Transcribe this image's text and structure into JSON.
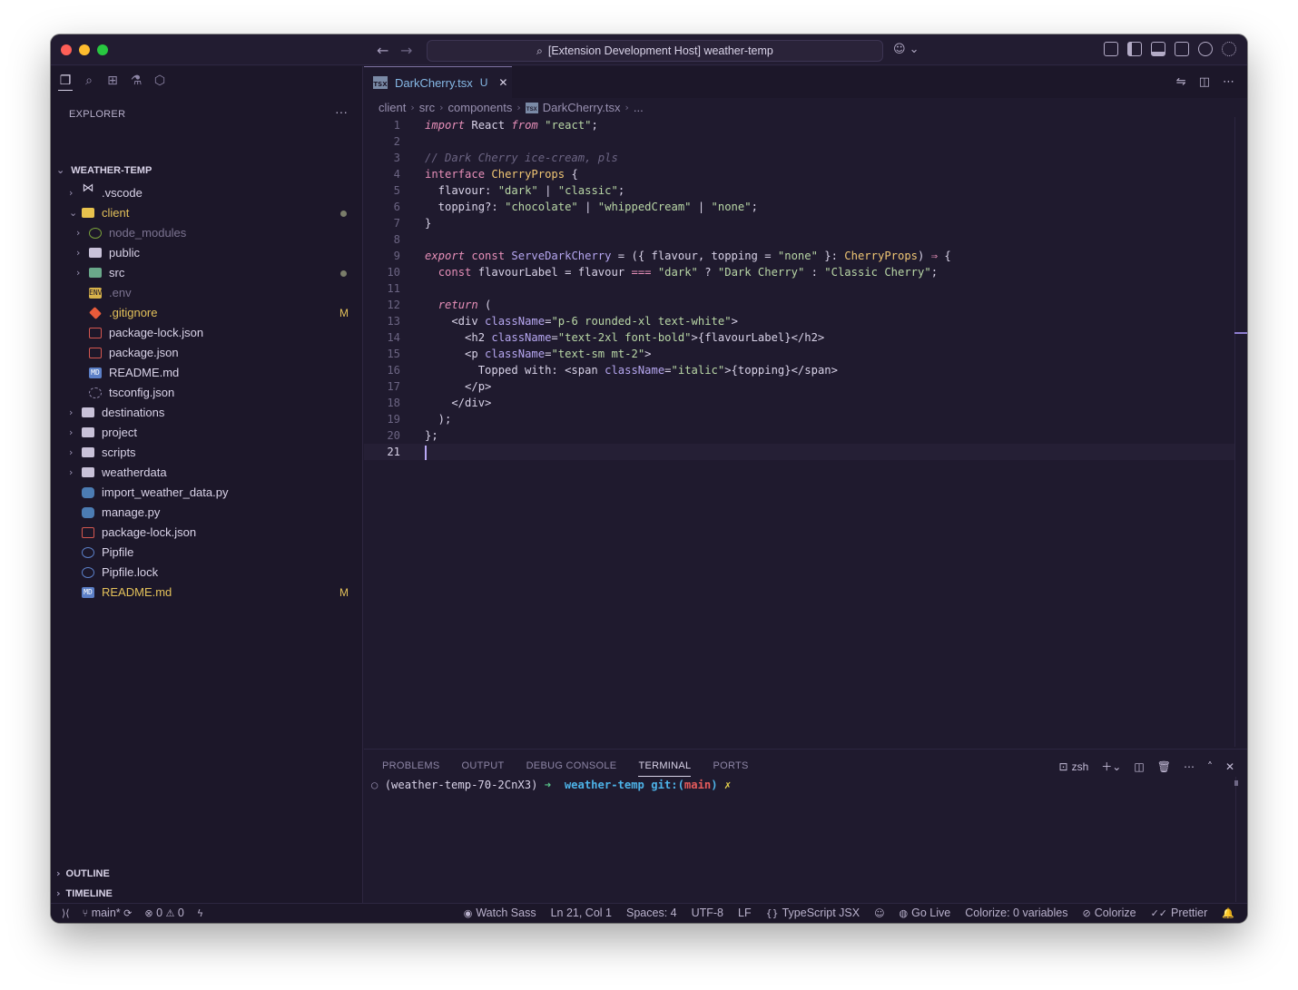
{
  "window": {
    "command_center": "[Extension Development Host] weather-temp"
  },
  "explorer": {
    "title": "EXPLORER",
    "more": "···",
    "root": "WEATHER-TEMP",
    "items": [
      {
        "name": ".vscode",
        "depth": 1,
        "kind": "folder-vs",
        "expanded": false
      },
      {
        "name": "client",
        "depth": 1,
        "kind": "folder-open",
        "expanded": true,
        "dot": true,
        "color": "yellow"
      },
      {
        "name": "node_modules",
        "depth": 2,
        "kind": "node",
        "expanded": false,
        "dim": true
      },
      {
        "name": "public",
        "depth": 2,
        "kind": "folder",
        "expanded": false
      },
      {
        "name": "src",
        "depth": 2,
        "kind": "folder-src",
        "expanded": false,
        "dot": true
      },
      {
        "name": ".env",
        "depth": 2,
        "kind": "env",
        "dim": true
      },
      {
        "name": ".gitignore",
        "depth": 2,
        "kind": "git",
        "badge": "M",
        "color": "yellow"
      },
      {
        "name": "package-lock.json",
        "depth": 2,
        "kind": "json"
      },
      {
        "name": "package.json",
        "depth": 2,
        "kind": "json"
      },
      {
        "name": "README.md",
        "depth": 2,
        "kind": "md"
      },
      {
        "name": "tsconfig.json",
        "depth": 2,
        "kind": "ts"
      },
      {
        "name": "destinations",
        "depth": 1,
        "kind": "folder",
        "expanded": false
      },
      {
        "name": "project",
        "depth": 1,
        "kind": "folder",
        "expanded": false
      },
      {
        "name": "scripts",
        "depth": 1,
        "kind": "folder",
        "expanded": false
      },
      {
        "name": "weatherdata",
        "depth": 1,
        "kind": "folder",
        "expanded": false
      },
      {
        "name": "import_weather_data.py",
        "depth": 1,
        "kind": "py"
      },
      {
        "name": "manage.py",
        "depth": 1,
        "kind": "py"
      },
      {
        "name": "package-lock.json",
        "depth": 1,
        "kind": "json"
      },
      {
        "name": "Pipfile",
        "depth": 1,
        "kind": "pip"
      },
      {
        "name": "Pipfile.lock",
        "depth": 1,
        "kind": "pip"
      },
      {
        "name": "README.md",
        "depth": 1,
        "kind": "md",
        "badge": "M",
        "color": "yellow"
      }
    ],
    "outline": "OUTLINE",
    "timeline": "TIMELINE"
  },
  "editor": {
    "tab": {
      "name": "DarkCherry.tsx",
      "status": "U",
      "icon": "TSX"
    },
    "breadcrumb": [
      "client",
      "src",
      "components",
      "DarkCherry.tsx",
      "..."
    ],
    "current_line": 21,
    "lines": [
      [
        {
          "t": "import",
          "c": "kw"
        },
        {
          "t": " React ",
          "c": ""
        },
        {
          "t": "from",
          "c": "kw"
        },
        {
          "t": " ",
          "c": ""
        },
        {
          "t": "\"react\"",
          "c": "str"
        },
        {
          "t": ";",
          "c": ""
        }
      ],
      [],
      [
        {
          "t": "// Dark Cherry ice-cream, pls",
          "c": "cm"
        }
      ],
      [
        {
          "t": "interface",
          "c": "kw2"
        },
        {
          "t": " ",
          "c": ""
        },
        {
          "t": "CherryProps",
          "c": "ty"
        },
        {
          "t": " {",
          "c": ""
        }
      ],
      [
        {
          "t": "  flavour: ",
          "c": ""
        },
        {
          "t": "\"dark\"",
          "c": "str"
        },
        {
          "t": " | ",
          "c": ""
        },
        {
          "t": "\"classic\"",
          "c": "str"
        },
        {
          "t": ";",
          "c": ""
        }
      ],
      [
        {
          "t": "  topping?: ",
          "c": ""
        },
        {
          "t": "\"chocolate\"",
          "c": "str"
        },
        {
          "t": " | ",
          "c": ""
        },
        {
          "t": "\"whippedCream\"",
          "c": "str"
        },
        {
          "t": " | ",
          "c": ""
        },
        {
          "t": "\"none\"",
          "c": "str"
        },
        {
          "t": ";",
          "c": ""
        }
      ],
      [
        {
          "t": "}",
          "c": ""
        }
      ],
      [],
      [
        {
          "t": "export",
          "c": "kw"
        },
        {
          "t": " ",
          "c": ""
        },
        {
          "t": "const",
          "c": "kw2"
        },
        {
          "t": " ",
          "c": ""
        },
        {
          "t": "ServeDarkCherry",
          "c": "fn"
        },
        {
          "t": " = ({ flavour, topping = ",
          "c": ""
        },
        {
          "t": "\"none\"",
          "c": "str"
        },
        {
          "t": " }: ",
          "c": ""
        },
        {
          "t": "CherryProps",
          "c": "ty"
        },
        {
          "t": ") ",
          "c": ""
        },
        {
          "t": "⇒",
          "c": "op"
        },
        {
          "t": " {",
          "c": ""
        }
      ],
      [
        {
          "t": "  ",
          "c": ""
        },
        {
          "t": "const",
          "c": "kw2"
        },
        {
          "t": " flavourLabel = flavour ",
          "c": ""
        },
        {
          "t": "===",
          "c": "op"
        },
        {
          "t": " ",
          "c": ""
        },
        {
          "t": "\"dark\"",
          "c": "str"
        },
        {
          "t": " ? ",
          "c": ""
        },
        {
          "t": "\"Dark Cherry\"",
          "c": "str"
        },
        {
          "t": " : ",
          "c": ""
        },
        {
          "t": "\"Classic Cherry\"",
          "c": "str"
        },
        {
          "t": ";",
          "c": ""
        }
      ],
      [],
      [
        {
          "t": "  ",
          "c": ""
        },
        {
          "t": "return",
          "c": "kw"
        },
        {
          "t": " (",
          "c": ""
        }
      ],
      [
        {
          "t": "    <div ",
          "c": "tg"
        },
        {
          "t": "className",
          "c": "at"
        },
        {
          "t": "=",
          "c": ""
        },
        {
          "t": "\"p-6 rounded-xl text-white\"",
          "c": "str"
        },
        {
          "t": ">",
          "c": ""
        }
      ],
      [
        {
          "t": "      <h2 ",
          "c": "tg"
        },
        {
          "t": "className",
          "c": "at"
        },
        {
          "t": "=",
          "c": ""
        },
        {
          "t": "\"text-2xl font-bold\"",
          "c": "str"
        },
        {
          "t": ">{flavourLabel}</h2>",
          "c": ""
        }
      ],
      [
        {
          "t": "      <p ",
          "c": "tg"
        },
        {
          "t": "className",
          "c": "at"
        },
        {
          "t": "=",
          "c": ""
        },
        {
          "t": "\"text-sm mt-2\"",
          "c": "str"
        },
        {
          "t": ">",
          "c": ""
        }
      ],
      [
        {
          "t": "        Topped with: <span ",
          "c": ""
        },
        {
          "t": "className",
          "c": "at"
        },
        {
          "t": "=",
          "c": ""
        },
        {
          "t": "\"italic\"",
          "c": "str"
        },
        {
          "t": ">{topping}</span>",
          "c": ""
        }
      ],
      [
        {
          "t": "      </p>",
          "c": ""
        }
      ],
      [
        {
          "t": "    </div>",
          "c": ""
        }
      ],
      [
        {
          "t": "  );",
          "c": ""
        }
      ],
      [
        {
          "t": "};",
          "c": ""
        }
      ],
      []
    ]
  },
  "panel": {
    "tabs": [
      "PROBLEMS",
      "OUTPUT",
      "DEBUG CONSOLE",
      "TERMINAL",
      "PORTS"
    ],
    "active_tab": "TERMINAL",
    "shell": "zsh",
    "terminal": {
      "env": "(weather-temp-70-2CnX3)",
      "arrow": "➜",
      "dir": "weather-temp",
      "git": "git:(",
      "branch": "main",
      "git_close": ")",
      "dirty": "✗"
    }
  },
  "status": {
    "branch": "main*",
    "errors": "0",
    "warnings": "0",
    "right": [
      "Watch Sass",
      "Ln 21, Col 1",
      "Spaces: 4",
      "UTF-8",
      "LF",
      "TypeScript JSX",
      "Go Live",
      "Colorize: 0 variables",
      "Colorize",
      "Prettier"
    ]
  }
}
